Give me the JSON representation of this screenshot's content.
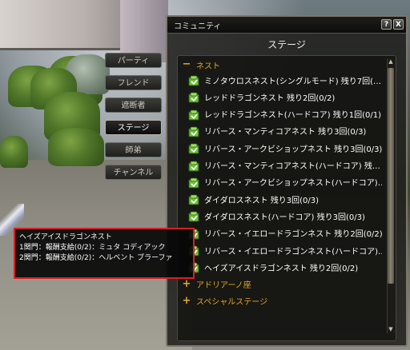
{
  "window": {
    "title": "コミュニティ",
    "help_label": "?",
    "close_label": "X"
  },
  "side_tabs": [
    {
      "label": "パーティ",
      "active": false
    },
    {
      "label": "フレンド",
      "active": false
    },
    {
      "label": "遮断者",
      "active": false
    },
    {
      "label": "ステージ",
      "active": true
    },
    {
      "label": "師弟",
      "active": false
    },
    {
      "label": "チャンネル",
      "active": false
    }
  ],
  "stage": {
    "header": "ステージ",
    "categories": [
      {
        "symbol": "−",
        "label": "ネスト",
        "expanded": true,
        "items": [
          "ミノタウロスネスト(シングルモード) 残り7回(…",
          "レッドドラゴンネスト 残り2回(0/2)",
          "レッドドラゴンネスト(ハードコア) 残り1回(0/1)",
          "リバース・マンティコアネスト 残り3回(0/3)",
          "リバース・アークビショップネスト 残り3回(0/3)",
          "リバース・マンティコアネスト(ハードコア) 残…",
          "リバース・アークビショップネスト(ハードコア)…",
          "ダイダロスネスト 残り3回(0/3)",
          "ダイダロスネスト(ハードコア) 残り3回(0/3)",
          "リバース・イエロードラゴンネスト 残り2回(0/2)",
          "リバース・イエロードラゴンネスト(ハードコア)…",
          "ヘイズアイスドラゴンネスト 残り2回(0/2)"
        ]
      },
      {
        "symbol": "+",
        "label": "アドリアーノ座",
        "expanded": false
      },
      {
        "symbol": "+",
        "label": "スペシャルステージ",
        "expanded": false
      }
    ],
    "scroll": {
      "up": "▲",
      "down": "▼"
    }
  },
  "tooltip": {
    "title": "ヘイズアイスドラゴンネスト",
    "lines": [
      "1関門：報酬支給(0/2)：ミュタ コディアック",
      "2関門：報酬支給(0/2)：ヘルベント ブラーファ"
    ]
  },
  "colors": {
    "category": "#e3a826",
    "item_text": "#ffffff",
    "tooltip_border": "#d81f26",
    "icon_green": "#6fc13a"
  }
}
